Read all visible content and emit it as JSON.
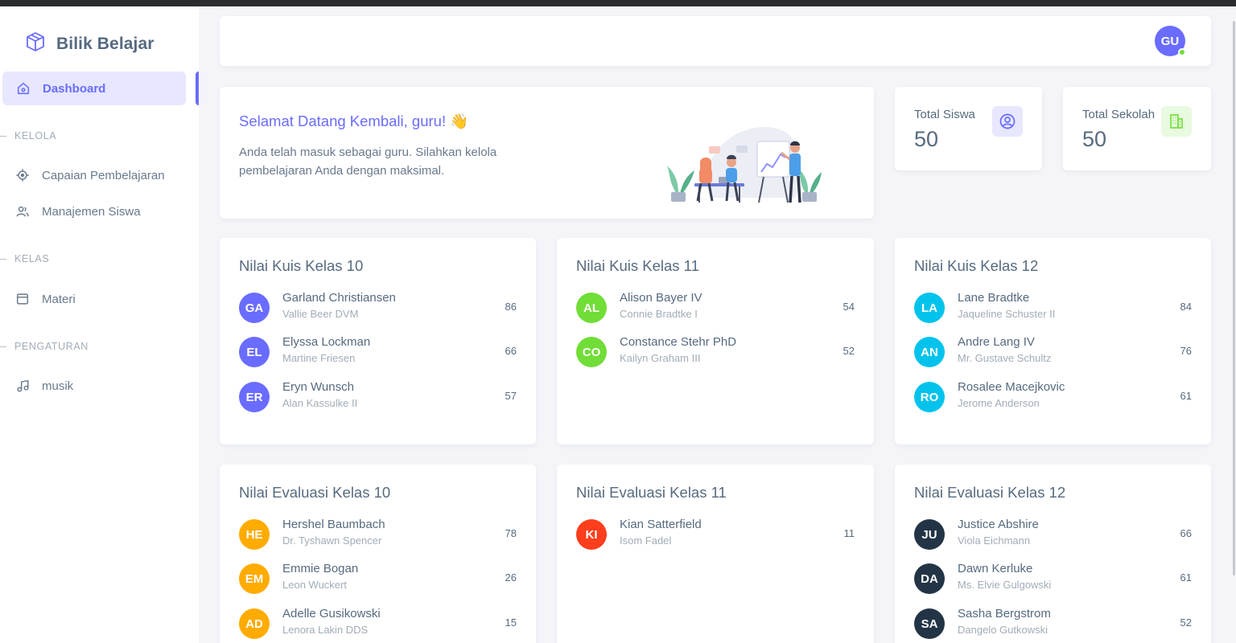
{
  "brand": {
    "name": "Bilik Belajar",
    "icon": "box-icon"
  },
  "sidebar": {
    "active": {
      "label": "Dashboard",
      "icon": "home-icon"
    },
    "sections": [
      {
        "title": "KELOLA",
        "items": [
          {
            "label": "Capaian Pembelajaran",
            "icon": "target-icon"
          },
          {
            "label": "Manajemen Siswa",
            "icon": "users-icon"
          }
        ]
      },
      {
        "title": "KELAS",
        "items": [
          {
            "label": "Materi",
            "icon": "window-icon"
          }
        ]
      },
      {
        "title": "PENGATURAN",
        "items": [
          {
            "label": "musik",
            "icon": "music-note-icon"
          }
        ]
      }
    ]
  },
  "navbar": {
    "avatar_initials": "GU",
    "status_color": "#71dd37"
  },
  "welcome": {
    "title": "Selamat Datang Kembali, guru! 👋",
    "text": "Anda telah masuk sebagai guru. Silahkan kelola pembelajaran Anda dengan maksimal."
  },
  "stats": [
    {
      "label": "Total Siswa",
      "value": "50",
      "icon": "user-circle-icon",
      "color": "#696cff",
      "bg": "#e7e7ff"
    },
    {
      "label": "Total Sekolah",
      "value": "50",
      "icon": "building-icon",
      "color": "#71dd37",
      "bg": "#e8fadf"
    }
  ],
  "colors": {
    "primary": "#696cff",
    "success": "#71dd37",
    "info": "#03c3ec",
    "warning": "#ffab00",
    "danger": "#ff3e1d",
    "dark": "#233446"
  },
  "lists": [
    {
      "title": "Nilai Kuis Kelas 10",
      "color": "#696cff",
      "rows": [
        {
          "initials": "GA",
          "name": "Garland Christiansen",
          "sub": "Vallie Beer DVM",
          "score": "86"
        },
        {
          "initials": "EL",
          "name": "Elyssa Lockman",
          "sub": "Martine Friesen",
          "score": "66"
        },
        {
          "initials": "ER",
          "name": "Eryn Wunsch",
          "sub": "Alan Kassulke II",
          "score": "57"
        }
      ]
    },
    {
      "title": "Nilai Kuis Kelas 11",
      "color": "#71dd37",
      "rows": [
        {
          "initials": "AL",
          "name": "Alison Bayer IV",
          "sub": "Connie Bradtke I",
          "score": "54"
        },
        {
          "initials": "CO",
          "name": "Constance Stehr PhD",
          "sub": "Kailyn Graham III",
          "score": "52"
        }
      ]
    },
    {
      "title": "Nilai Kuis Kelas 12",
      "color": "#03c3ec",
      "rows": [
        {
          "initials": "LA",
          "name": "Lane Bradtke",
          "sub": "Jaqueline Schuster II",
          "score": "84"
        },
        {
          "initials": "AN",
          "name": "Andre Lang IV",
          "sub": "Mr. Gustave Schultz",
          "score": "76"
        },
        {
          "initials": "RO",
          "name": "Rosalee Macejkovic",
          "sub": "Jerome Anderson",
          "score": "61"
        }
      ]
    },
    {
      "title": "Nilai Evaluasi Kelas 10",
      "color": "#ffab00",
      "rows": [
        {
          "initials": "HE",
          "name": "Hershel Baumbach",
          "sub": "Dr. Tyshawn Spencer",
          "score": "78"
        },
        {
          "initials": "EM",
          "name": "Emmie Bogan",
          "sub": "Leon Wuckert",
          "score": "26"
        },
        {
          "initials": "AD",
          "name": "Adelle Gusikowski",
          "sub": "Lenora Lakin DDS",
          "score": "15"
        }
      ]
    },
    {
      "title": "Nilai Evaluasi Kelas 11",
      "color": "#ff3e1d",
      "rows": [
        {
          "initials": "KI",
          "name": "Kian Satterfield",
          "sub": "Isom Fadel",
          "score": "11"
        }
      ]
    },
    {
      "title": "Nilai Evaluasi Kelas 12",
      "color": "#233446",
      "rows": [
        {
          "initials": "JU",
          "name": "Justice Abshire",
          "sub": "Viola Eichmann",
          "score": "66"
        },
        {
          "initials": "DA",
          "name": "Dawn Kerluke",
          "sub": "Ms. Elvie Gulgowski",
          "score": "61"
        },
        {
          "initials": "SA",
          "name": "Sasha Bergstrom",
          "sub": "Dangelo Gutkowski",
          "score": "52"
        }
      ]
    }
  ]
}
